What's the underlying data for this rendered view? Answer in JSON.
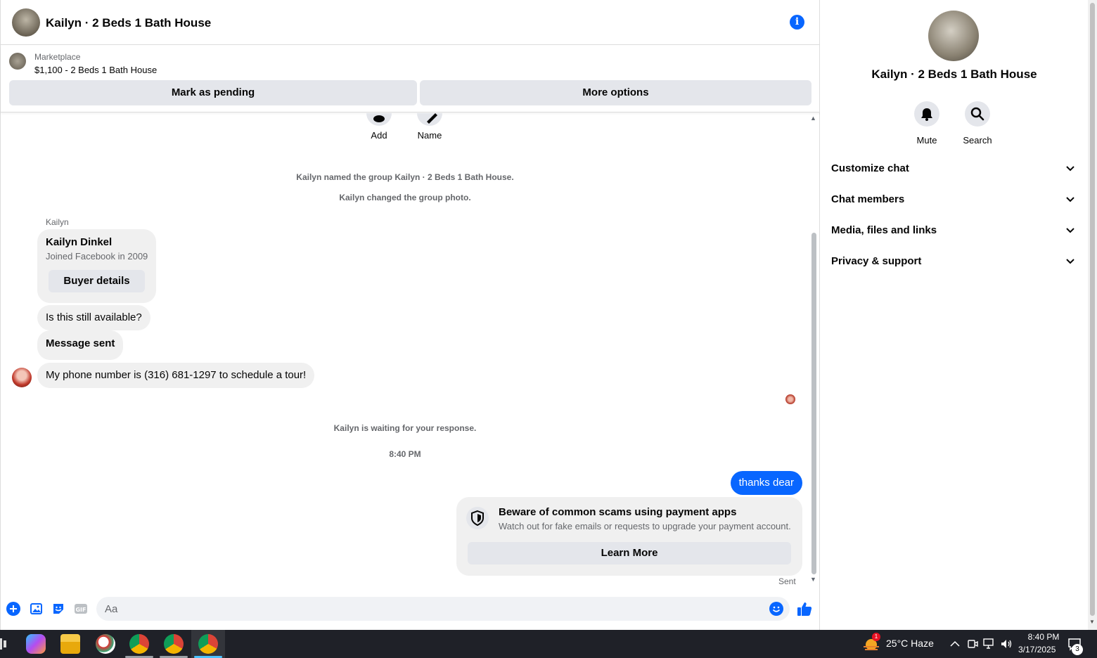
{
  "header": {
    "title": "Kailyn · 2 Beds 1 Bath House",
    "info_glyph": "i"
  },
  "listing": {
    "category": "Marketplace",
    "name": "$1,100 - 2 Beds 1 Bath House",
    "mark_pending": "Mark as pending",
    "more_options": "More options"
  },
  "group_actions": {
    "add": "Add",
    "name": "Name"
  },
  "messages": {
    "system_named": "Kailyn named the group Kailyn · 2 Beds 1 Bath House.",
    "system_photo": "Kailyn changed the group photo.",
    "sender": "Kailyn",
    "buyer_card": {
      "name": "Kailyn Dinkel",
      "joined": "Joined Facebook in 2009",
      "button": "Buyer details"
    },
    "msg1": "Is this still available?",
    "msg2": "Message sent",
    "msg3": "My phone number is (316) 681-1297 to schedule a tour!",
    "waiting": "Kailyn is waiting for your response.",
    "timestamp": "8:40 PM",
    "outgoing": "thanks dear",
    "scam": {
      "title": "Beware of common scams using payment apps",
      "subtitle": "Watch out for fake emails or requests to upgrade your payment account.",
      "button": "Learn More"
    },
    "status": "Sent"
  },
  "composer": {
    "placeholder": "Aa",
    "gif_label": "GIF"
  },
  "panel": {
    "title": "Kailyn · 2 Beds 1 Bath House",
    "mute": "Mute",
    "search": "Search",
    "sections": [
      "Customize chat",
      "Chat members",
      "Media, files and links",
      "Privacy & support"
    ]
  },
  "taskbar": {
    "weather": "25°C  Haze",
    "weather_badge": "1",
    "time": "8:40 PM",
    "date": "3/17/2025",
    "notifications": "3"
  },
  "colors": {
    "accent": "#0866ff",
    "bubble": "#f0f0f0",
    "button": "#e4e6eb",
    "taskbar": "#1f2128"
  }
}
